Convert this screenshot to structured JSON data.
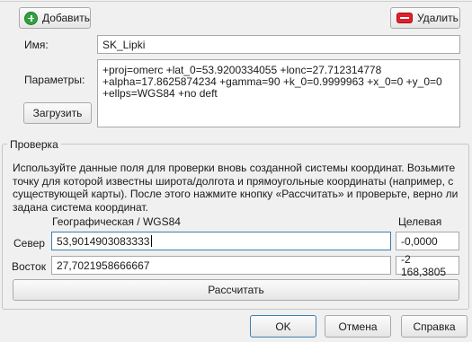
{
  "toolbar": {
    "add_label": "Добавить",
    "delete_label": "Удалить"
  },
  "fields": {
    "name_label": "Имя:",
    "name_value": "SK_Lipki",
    "params_label": "Параметры:",
    "params_value": "+proj=omerc +lat_0=53.9200334055 +lonc=27.712314778\n+alpha=17.8625874234 +gamma=90 +k_0=0.9999963 +x_0=0 +y_0=0\n+ellps=WGS84 +no deft",
    "load_label": "Загрузить"
  },
  "check": {
    "group_title": "Проверка",
    "description": "Используйте данные поля для проверки вновь созданной системы координат. Возьмите точку для которой известны широта/долгота и прямоугольные координаты (например, с существующей карты). После этого нажмите кнопку «Рассчитать» и проверьте, верно ли задана система координат.",
    "geo_header": "Географическая / WGS84",
    "target_header": "Целевая",
    "north_label": "Север",
    "north_value": "53,9014903083333",
    "north_result": "-0,0000",
    "east_label": "Восток",
    "east_value": "27,7021958666667",
    "east_result": "-2 168,3805",
    "calculate_label": "Рассчитать"
  },
  "footer": {
    "ok_label": "OK",
    "cancel_label": "Отмена",
    "help_label": "Справка"
  },
  "colors": {
    "add_icon": "#2fa23d",
    "delete_icon": "#e0202a",
    "focus_border": "#3c7fb1"
  }
}
